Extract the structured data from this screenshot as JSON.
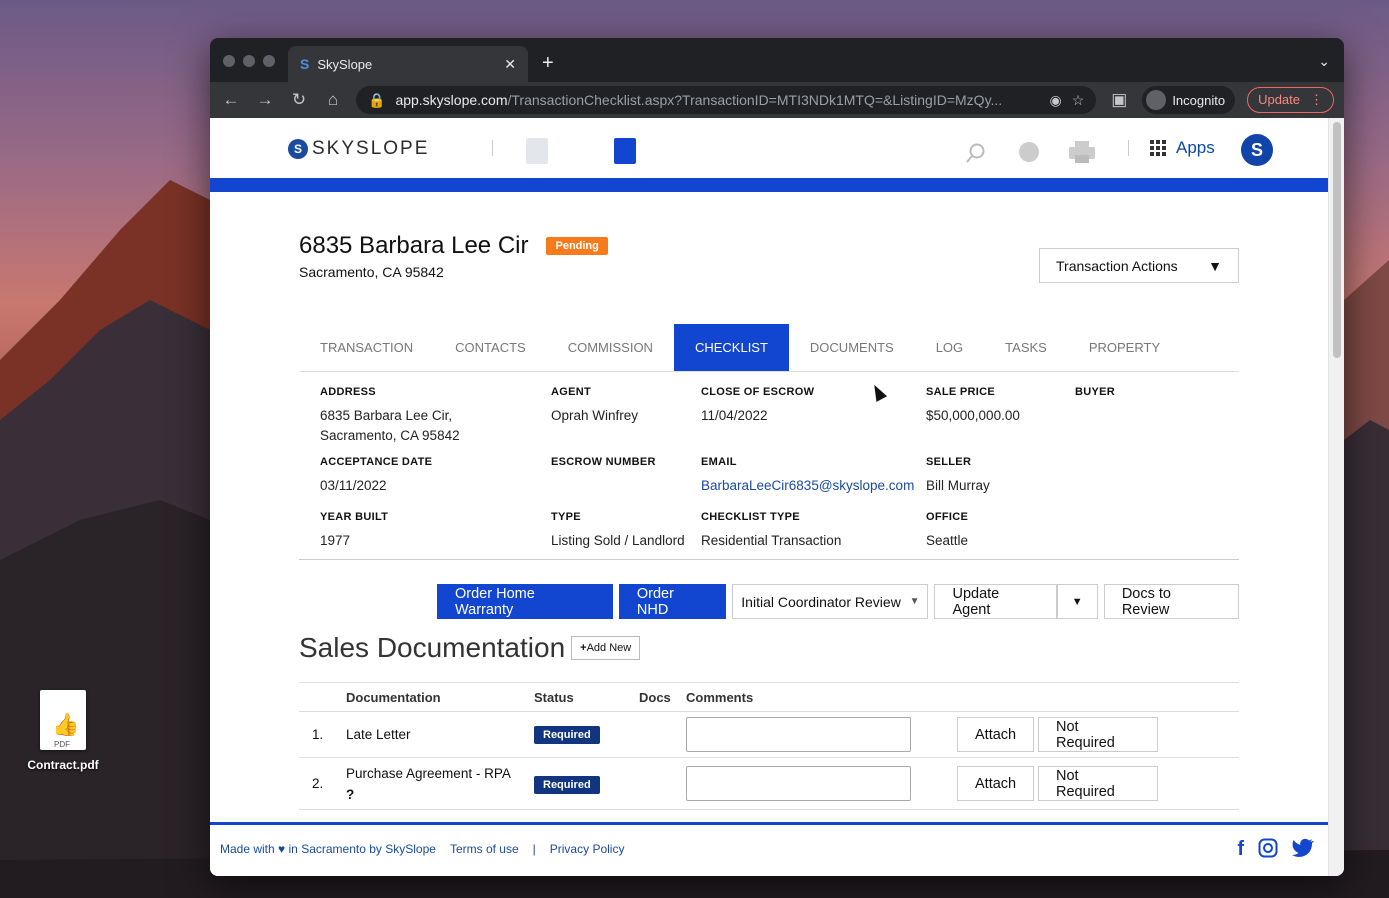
{
  "desktop": {
    "file_name": "Contract.pdf",
    "file_type": "PDF"
  },
  "browser": {
    "tab_title": "SkySlope",
    "url_host": "app.skyslope.com",
    "url_path": "/TransactionChecklist.aspx?TransactionID=MTI3NDk1MTQ=&ListingID=MzQy...",
    "incognito_label": "Incognito",
    "update_label": "Update"
  },
  "header": {
    "logo_text": "SKYSLOPE",
    "apps_label": "Apps"
  },
  "property": {
    "title": "6835 Barbara Lee Cir",
    "status": "Pending",
    "subtitle": "Sacramento, CA 95842",
    "actions_label": "Transaction Actions"
  },
  "tabs": [
    {
      "label": "TRANSACTION"
    },
    {
      "label": "CONTACTS"
    },
    {
      "label": "COMMISSION"
    },
    {
      "label": "CHECKLIST"
    },
    {
      "label": "DOCUMENTS"
    },
    {
      "label": "LOG"
    },
    {
      "label": "TASKS"
    },
    {
      "label": "PROPERTY"
    }
  ],
  "details": {
    "address_label": "ADDRESS",
    "address_line1": "6835 Barbara Lee Cir,",
    "address_line2": "Sacramento, CA 95842",
    "agent_label": "AGENT",
    "agent": "Oprah Winfrey",
    "close_label": "CLOSE OF ESCROW",
    "close": "11/04/2022",
    "price_label": "SALE PRICE",
    "price": "$50,000,000.00",
    "buyer_label": "BUYER",
    "acceptance_label": "ACCEPTANCE DATE",
    "acceptance": "03/11/2022",
    "escrow_label": "ESCROW NUMBER",
    "email_label": "EMAIL",
    "email": "BarbaraLeeCir6835@skyslope.com",
    "seller_label": "SELLER",
    "seller": "Bill Murray",
    "year_label": "YEAR BUILT",
    "year": "1977",
    "type_label": "TYPE",
    "type": "Listing Sold / Landlord",
    "checklist_label": "CHECKLIST TYPE",
    "checklist": "Residential Transaction",
    "office_label": "OFFICE",
    "office": "Seattle"
  },
  "action_bar": {
    "warranty": "Order Home Warranty",
    "nhd": "Order NHD",
    "review_select": "Initial Coordinator Review",
    "update_agent": "Update Agent",
    "docs_review": "Docs to Review"
  },
  "sales": {
    "title": "Sales Documentation",
    "add_new": "Add New",
    "columns": {
      "documentation": "Documentation",
      "status": "Status",
      "docs": "Docs",
      "comments": "Comments"
    },
    "rows": [
      {
        "num": "1.",
        "name": "Late Letter",
        "status": "Required",
        "attach": "Attach",
        "not_required": "Not Required"
      },
      {
        "num": "2.",
        "name": "Purchase Agreement - RPA",
        "help": "?",
        "status": "Required",
        "attach": "Attach",
        "not_required": "Not Required"
      }
    ]
  },
  "footer": {
    "made_with": "Made with",
    "made_in": "in Sacramento by SkySlope",
    "terms": "Terms of use",
    "separator": "|",
    "privacy": "Privacy Policy"
  },
  "colors": {
    "brand_blue": "#1246d1",
    "pending_orange": "#f77b1c",
    "required_navy": "#12357f"
  }
}
